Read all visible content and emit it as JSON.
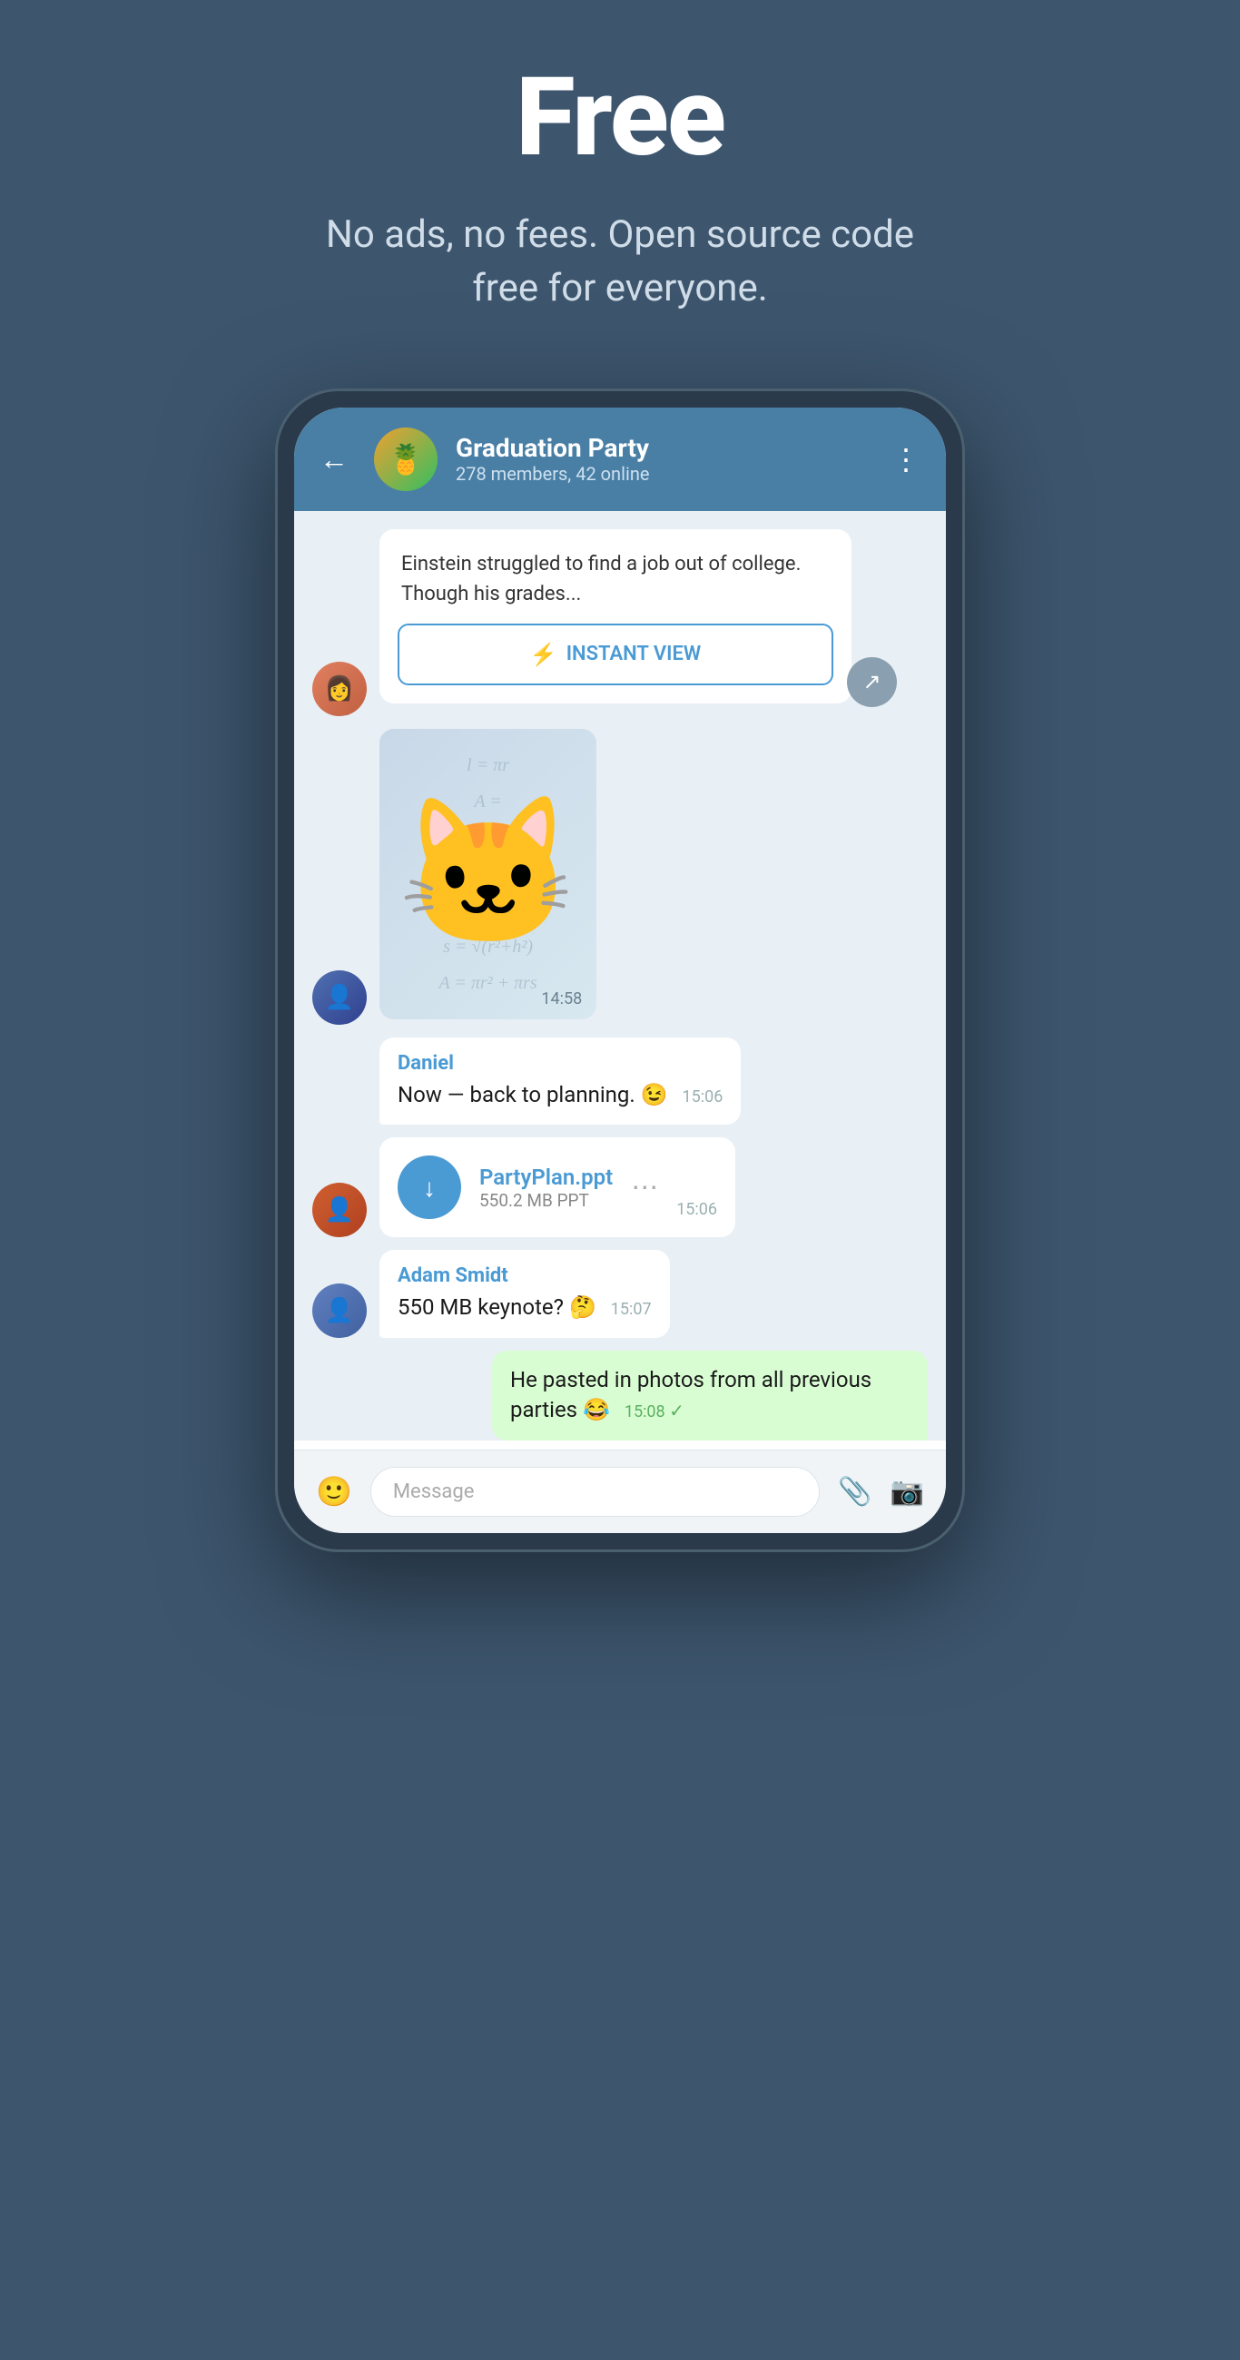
{
  "hero": {
    "title": "Free",
    "subtitle": "No ads, no fees. Open source code free for everyone."
  },
  "chat": {
    "header": {
      "back_label": "←",
      "group_name": "Graduation Party",
      "group_meta": "278 members, 42 online",
      "more_icon": "⋮",
      "avatar_emoji": "🍍"
    },
    "article": {
      "text": "Einstein struggled to find a job out of college. Though his grades...",
      "instant_view_label": "INSTANT VIEW"
    },
    "sticker_time": "14:58",
    "messages": [
      {
        "sender": "Daniel",
        "text": "Now — back to planning. 😉",
        "time": "15:06",
        "own": false
      }
    ],
    "file": {
      "name": "PartyPlan.ppt",
      "size": "550.2 MB PPT",
      "time": "15:06"
    },
    "adam_message": {
      "sender": "Adam Smidt",
      "text": "550 MB keynote? 🤔",
      "time": "15:07"
    },
    "own_message": {
      "text": "He pasted in photos from all previous parties 😂",
      "time": "15:08"
    },
    "input": {
      "placeholder": "Message"
    }
  }
}
